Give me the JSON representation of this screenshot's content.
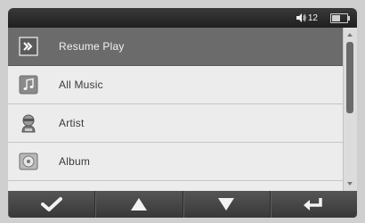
{
  "status": {
    "volume_level": "12",
    "battery_level": 0.55
  },
  "menu": {
    "items": [
      {
        "label": "Resume Play",
        "icon": "resume-play-icon",
        "selected": true
      },
      {
        "label": "All Music",
        "icon": "music-note-icon",
        "selected": false
      },
      {
        "label": "Artist",
        "icon": "artist-icon",
        "selected": false
      },
      {
        "label": "Album",
        "icon": "album-disc-icon",
        "selected": false
      }
    ]
  },
  "scroll": {
    "position": 0,
    "visible_fraction": 0.45
  },
  "toolbar": {
    "buttons": [
      {
        "icon": "checkmark-icon"
      },
      {
        "icon": "up-arrow-icon"
      },
      {
        "icon": "down-arrow-icon"
      },
      {
        "icon": "return-icon"
      }
    ]
  },
  "colors": {
    "selected_row": "#6b6b6b",
    "toolbar": "#454545",
    "text": "#3a3a3a"
  }
}
